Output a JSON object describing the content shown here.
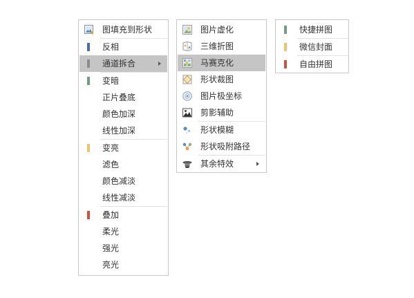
{
  "colors": {
    "blue": "#4a6fa5",
    "gray": "#8c8c8c",
    "green": "#6e9e84",
    "yellow": "#f0c46e",
    "red": "#c8553d",
    "active_bg": "#c5c5c5"
  },
  "menu1": {
    "items": [
      {
        "label": "图填充到形状",
        "icon": "image-fill-icon"
      },
      {
        "label": "反相",
        "icon": "blue-bar-icon"
      },
      {
        "label": "通道拆合",
        "icon": "gray-bar-icon"
      },
      {
        "label": "变暗",
        "icon": "green-bar-icon"
      },
      {
        "label": "正片叠底"
      },
      {
        "label": "颜色加深"
      },
      {
        "label": "线性加深"
      },
      {
        "label": "变亮",
        "icon": "yellow-bar-icon"
      },
      {
        "label": "滤色"
      },
      {
        "label": "颜色减淡"
      },
      {
        "label": "线性减淡"
      },
      {
        "label": "叠加",
        "icon": "red-bar-icon"
      },
      {
        "label": "柔光"
      },
      {
        "label": "强光"
      },
      {
        "label": "亮光"
      }
    ]
  },
  "menu2": {
    "items": [
      {
        "label": "图片虚化",
        "icon": "picture-blur-icon"
      },
      {
        "label": "三维折图",
        "icon": "3d-fold-icon"
      },
      {
        "label": "马赛克化",
        "icon": "mosaic-icon"
      },
      {
        "label": "形状裁图",
        "icon": "shape-crop-icon"
      },
      {
        "label": "图片极坐标",
        "icon": "polar-coordinates-icon"
      },
      {
        "label": "剪影辅助",
        "icon": "silhouette-icon"
      },
      {
        "label": "形状模糊",
        "icon": "shape-blur-icon"
      },
      {
        "label": "形状吸附路径",
        "icon": "shape-path-snap-icon"
      },
      {
        "label": "其余特效",
        "icon": "magic-hat-icon"
      }
    ]
  },
  "menu3": {
    "items": [
      {
        "label": "快捷拼图",
        "icon": "green-bar-icon"
      },
      {
        "label": "微信封面",
        "icon": "yellow-bar-icon"
      },
      {
        "label": "自由拼图",
        "icon": "red-bar-icon"
      }
    ]
  }
}
